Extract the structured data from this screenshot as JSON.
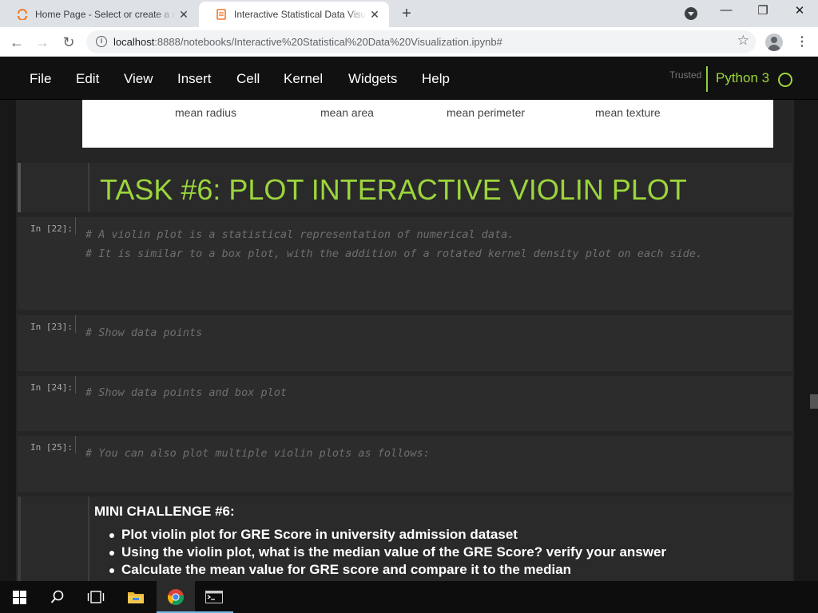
{
  "browser": {
    "tabs": [
      {
        "title": "Home Page - Select or create a notebook",
        "active": false
      },
      {
        "title": "Interactive Statistical Data Visualization",
        "active": true
      }
    ],
    "url_host": "localhost",
    "url_rest": ":8888/notebooks/Interactive%20Statistical%20Data%20Visualization.ipynb#"
  },
  "jupyter": {
    "menu": [
      "File",
      "Edit",
      "View",
      "Insert",
      "Cell",
      "Kernel",
      "Widgets",
      "Help"
    ],
    "trusted": "Trusted",
    "kernel": "Python 3"
  },
  "plot_labels": [
    "mean radius",
    "mean area",
    "mean perimeter",
    "mean texture"
  ],
  "task_heading": "TASK #6: PLOT INTERACTIVE VIOLIN PLOT",
  "cells": [
    {
      "prompt": "In [22]:",
      "lines": [
        "# A violin plot is a statistical representation of numerical data.",
        "# It is similar to a box plot, with the addition of a rotated kernel density plot on each side."
      ]
    },
    {
      "prompt": "In [23]:",
      "lines": [
        "# Show data points"
      ]
    },
    {
      "prompt": "In [24]:",
      "lines": [
        "# Show data points and box plot"
      ]
    },
    {
      "prompt": "In [25]:",
      "lines": [
        "# You can also plot multiple violin plots as follows:"
      ]
    }
  ],
  "challenge": {
    "title": "MINI CHALLENGE #6:",
    "items": [
      "Plot violin plot for GRE Score in university admission dataset",
      "Using the violin plot, what is the median value of the GRE Score? verify your answer",
      "Calculate the mean value for GRE score and compare it to the median"
    ]
  },
  "colors": {
    "accent": "#9cd53c",
    "background": "#252525"
  }
}
